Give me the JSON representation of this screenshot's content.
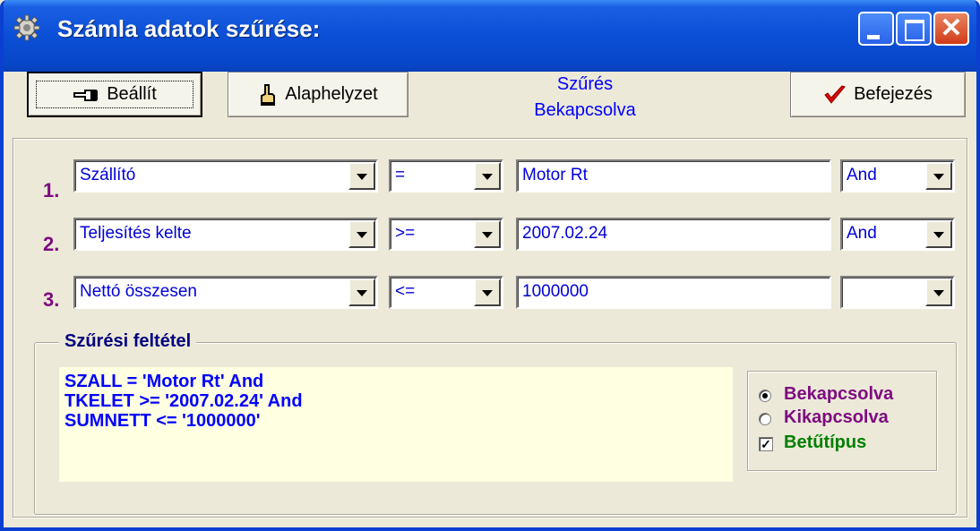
{
  "window": {
    "title": "Számla adatok szűrése:"
  },
  "toolbar": {
    "set_label": "Beállít",
    "reset_label": "Alaphelyzet",
    "status_line1": "Szűrés",
    "status_line2": "Bekapcsolva",
    "finish_label": "Befejezés"
  },
  "filters": [
    {
      "num": "1.",
      "field": "Szállító",
      "op": "=",
      "value": "Motor Rt",
      "logic": "And"
    },
    {
      "num": "2.",
      "field": "Teljesítés kelte",
      "op": ">=",
      "value": "2007.02.24",
      "logic": "And"
    },
    {
      "num": "3.",
      "field": "Nettó összesen",
      "op": "<=",
      "value": "1000000",
      "logic": ""
    }
  ],
  "condition": {
    "legend": "Szűrési feltétel",
    "lines": [
      "SZALL = 'Motor Rt' And",
      "TKELET >= '2007.02.24' And",
      "SUMNETT <= '1000000'"
    ]
  },
  "options": {
    "on_label": "Bekapcsolva",
    "off_label": "Kikapcsolva",
    "font_label": "Betűtípus",
    "selected": "on",
    "font_checked": true
  },
  "colors": {
    "title_blue": "#0a4fd6",
    "label_purple": "#7e0b80",
    "green": "#008000"
  }
}
